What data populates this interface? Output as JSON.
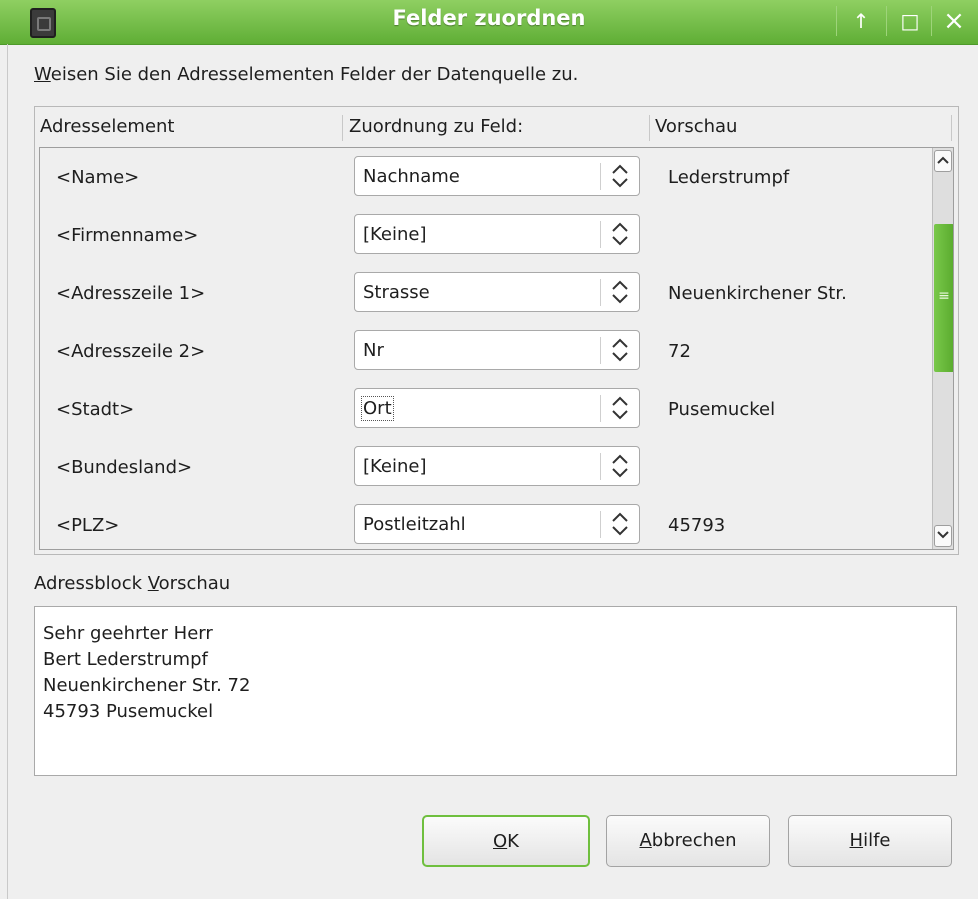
{
  "window": {
    "title": "Felder zuordnen",
    "controls": {
      "up": "↑",
      "maximize": "□",
      "close": "×"
    }
  },
  "instruction": {
    "mnemonic": "W",
    "rest": "eisen Sie den Adresselementen Felder der Datenquelle zu."
  },
  "table": {
    "headers": {
      "element": "Adresselement",
      "mapping": "Zuordnung zu Feld:",
      "preview": "Vorschau"
    },
    "rows": [
      {
        "element": "<Name>",
        "field": "Nachname",
        "preview": "Lederstrumpf"
      },
      {
        "element": "<Firmenname>",
        "field": "[Keine]",
        "preview": ""
      },
      {
        "element": "<Adresszeile 1>",
        "field": "Strasse",
        "preview": "Neuenkirchener Str."
      },
      {
        "element": "<Adresszeile 2>",
        "field": "Nr",
        "preview": "72"
      },
      {
        "element": "<Stadt>",
        "field": "Ort",
        "preview": "Pusemuckel"
      },
      {
        "element": "<Bundesland>",
        "field": "[Keine]",
        "preview": ""
      },
      {
        "element": "<PLZ>",
        "field": "Postleitzahl",
        "preview": "45793"
      }
    ],
    "scrollbar": {
      "grip": "≡"
    }
  },
  "preview_section": {
    "label_before": "Adressblock ",
    "label_mnemonic": "V",
    "label_after": "orschau",
    "lines": [
      "Sehr geehrter Herr",
      "Bert Lederstrumpf",
      "Neuenkirchener Str. 72",
      "45793 Pusemuckel"
    ]
  },
  "buttons": {
    "ok": {
      "mnemonic": "O",
      "rest": "K"
    },
    "cancel": {
      "mnemonic": "A",
      "rest": "bbrechen"
    },
    "help": {
      "mnemonic": "H",
      "rest": "ilfe"
    }
  },
  "colors": {
    "titlebar": "#6dbb3f",
    "accent": "#5aab2e"
  }
}
